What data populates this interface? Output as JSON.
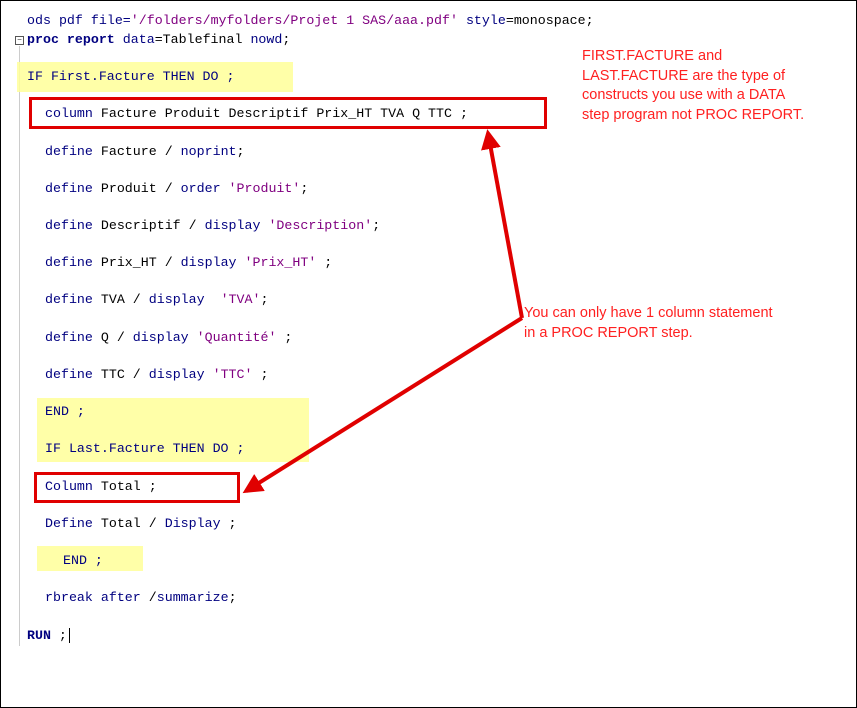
{
  "colors": {
    "highlight": "#ffff99",
    "keyword": "#000080",
    "string": "#800080",
    "annotation": "#ff2020",
    "box": "#e00000"
  },
  "editor": {
    "ods_kw1": "ods",
    "ods_kw2": "pdf",
    "ods_kw3": "file=",
    "ods_str": "'/folders/myfolders/Projet 1 SAS/aaa.pdf'",
    "ods_kw4": "style",
    "ods_plain": "=monospace;",
    "proc_kw": "proc report",
    "proc_kw2": "data",
    "proc_plain": "=Tablefinal",
    "proc_kw3": "nowd",
    "proc_end": ";",
    "if_first": "IF First.Facture THEN DO ;",
    "column_kw": "column",
    "column_plain": " Facture Produit Descriptif Prix_HT TVA Q TTC ;",
    "def1_kw": "define",
    "def1_plain": " Facture / ",
    "def1_kw2": "noprint",
    "def1_end": ";",
    "def2_kw": "define",
    "def2_plain": " Produit / ",
    "def2_kw2": "order",
    "def2_str": " 'Produit'",
    "def2_end": ";",
    "def3_kw": "define",
    "def3_plain": " Descriptif / ",
    "def3_kw2": "display",
    "def3_str": " 'Description'",
    "def3_end": ";",
    "def4_kw": "define",
    "def4_plain": " Prix_HT / ",
    "def4_kw2": "display",
    "def4_str": " 'Prix_HT'",
    "def4_end": " ;",
    "def5_kw": "define",
    "def5_plain": " TVA / ",
    "def5_kw2": "display",
    "def5_str": "  'TVA'",
    "def5_end": ";",
    "def6_kw": "define",
    "def6_plain": " Q / ",
    "def6_kw2": "display",
    "def6_str": " 'Quantité'",
    "def6_end": " ;",
    "def7_kw": "define",
    "def7_plain": " TTC / ",
    "def7_kw2": "display",
    "def7_str": " 'TTC'",
    "def7_end": " ;",
    "end1": "END ;",
    "if_last": "IF Last.Facture THEN DO ;",
    "col_total_kw": "Column",
    "col_total_plain": " Total ;",
    "def_total_kw": "Define",
    "def_total_plain": " Total / ",
    "def_total_kw2": "Display",
    "def_total_end": " ;",
    "end2": "END ;",
    "rbreak_kw": "rbreak after",
    "rbreak_plain": " /",
    "rbreak_kw2": "summarize",
    "rbreak_end": ";",
    "run": "RUN",
    "run_end": " ;"
  },
  "annotations": {
    "note1_line1": "FIRST.FACTURE and",
    "note1_line2": "LAST.FACTURE are the type of",
    "note1_line3": "constructs you use with a DATA",
    "note1_line4": "step program not PROC REPORT.",
    "note2_line1": "You can only have 1 column statement",
    "note2_line2": "in a PROC REPORT step."
  }
}
